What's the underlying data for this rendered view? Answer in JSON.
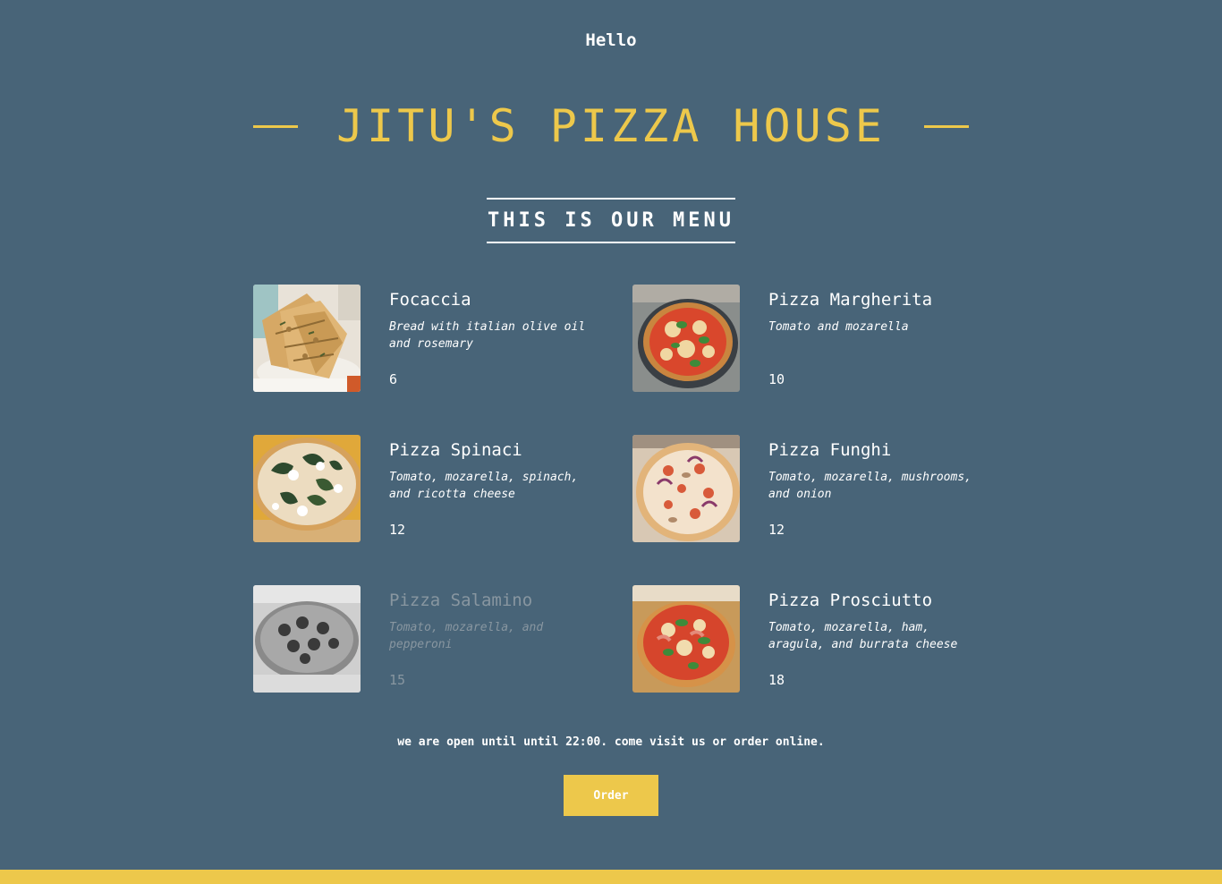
{
  "header": {
    "greeting": "Hello",
    "title": "JITU'S PIZZA HOUSE"
  },
  "menu": {
    "heading": "THIS IS OUR MENU",
    "items": [
      {
        "name": "Focaccia",
        "description": "Bread with italian olive oil and rosemary",
        "price": "6",
        "image": "focaccia-photo",
        "sold_out": false
      },
      {
        "name": "Pizza Margherita",
        "description": "Tomato and mozarella",
        "price": "10",
        "image": "margherita-photo",
        "sold_out": false
      },
      {
        "name": "Pizza Spinaci",
        "description": "Tomato, mozarella, spinach, and ricotta cheese",
        "price": "12",
        "image": "spinaci-photo",
        "sold_out": false
      },
      {
        "name": "Pizza Funghi",
        "description": "Tomato, mozarella, mushrooms, and onion",
        "price": "12",
        "image": "funghi-photo",
        "sold_out": false
      },
      {
        "name": "Pizza Salamino",
        "description": "Tomato, mozarella, and pepperoni",
        "price": "15",
        "image": "salamino-photo",
        "sold_out": true
      },
      {
        "name": "Pizza Prosciutto",
        "description": "Tomato, mozarella, ham, aragula, and burrata cheese",
        "price": "18",
        "image": "prosciutto-photo",
        "sold_out": false
      }
    ]
  },
  "footer": {
    "message": "we are open until until 22:00. come visit us or order online.",
    "order_label": "Order"
  },
  "colors": {
    "background": "#486478",
    "accent": "#edc84b",
    "text": "#ffffff",
    "sold_out_text": "#8896a0"
  }
}
